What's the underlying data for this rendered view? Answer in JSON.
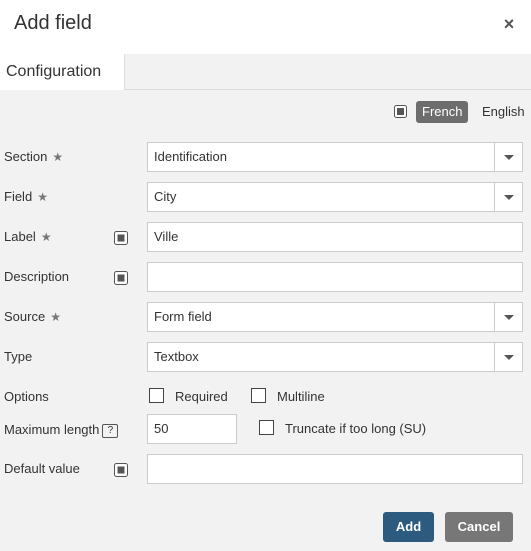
{
  "dialog": {
    "title": "Add field",
    "close": "×"
  },
  "tabs": [
    {
      "label": "Configuration"
    }
  ],
  "languages": {
    "french": "French",
    "english": "English"
  },
  "form": {
    "section": {
      "label": "Section",
      "value": "Identification"
    },
    "field": {
      "label": "Field",
      "value": "City"
    },
    "label_field": {
      "label": "Label",
      "value": "Ville"
    },
    "description": {
      "label": "Description",
      "value": ""
    },
    "source": {
      "label": "Source",
      "value": "Form field"
    },
    "type": {
      "label": "Type",
      "value": "Textbox"
    },
    "options": {
      "label": "Options",
      "required": "Required",
      "multiline": "Multiline"
    },
    "max_length": {
      "label": "Maximum length",
      "help": "?",
      "value": "50",
      "truncate": "Truncate if too long (SU)"
    },
    "default_value": {
      "label": "Default value",
      "value": ""
    }
  },
  "buttons": {
    "add": "Add",
    "cancel": "Cancel"
  },
  "required_marker": "★"
}
